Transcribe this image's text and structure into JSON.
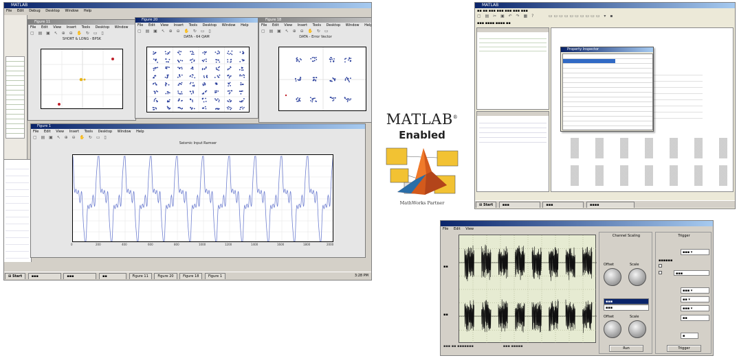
{
  "desktop": {
    "main_title": "MATLAB",
    "main_menu": [
      "File",
      "Edit",
      "Debug",
      "Desktop",
      "Window",
      "Help"
    ],
    "figure_menu": [
      "File",
      "Edit",
      "View",
      "Insert",
      "Tools",
      "Desktop",
      "Window",
      "Help"
    ],
    "fig1": {
      "title": "Figure 11",
      "plot_title": "SHORT & LONG - BPSK"
    },
    "fig2": {
      "title": "Figure 20",
      "plot_title": "DATA - 64 QAM"
    },
    "fig3": {
      "title": "Figure 18",
      "plot_title": "DATA - Error Vector"
    },
    "fig4": {
      "title": "Figure 1",
      "plot_title": "Seismic Input Ramser",
      "x_ticks": [
        "0",
        "200",
        "400",
        "600",
        "800",
        "1000",
        "1200",
        "1400",
        "1600",
        "1800",
        "2000"
      ]
    },
    "start_label": "Start",
    "taskbar_items": [
      "Figure 11",
      "Figure 20",
      "Figure 18",
      "Figure 1"
    ],
    "clock": "3:28 PM"
  },
  "logo": {
    "title": "MATLAB",
    "reg": "®",
    "enabled": "Enabled",
    "partner": "MathWorks Partner"
  },
  "inspector": {
    "title": "MATLAB",
    "dialog_title": "Property Inspector",
    "start_label": "Start"
  },
  "scope": {
    "menu": [
      "File",
      "Edit",
      "View"
    ],
    "channel_panel": "Channel Scaling",
    "trigger_panel": "Trigger",
    "knob_labels": [
      "Offset",
      "Scale",
      "Offset",
      "Scale"
    ],
    "run_button": "Run",
    "trigger_button": "Trigger"
  }
}
